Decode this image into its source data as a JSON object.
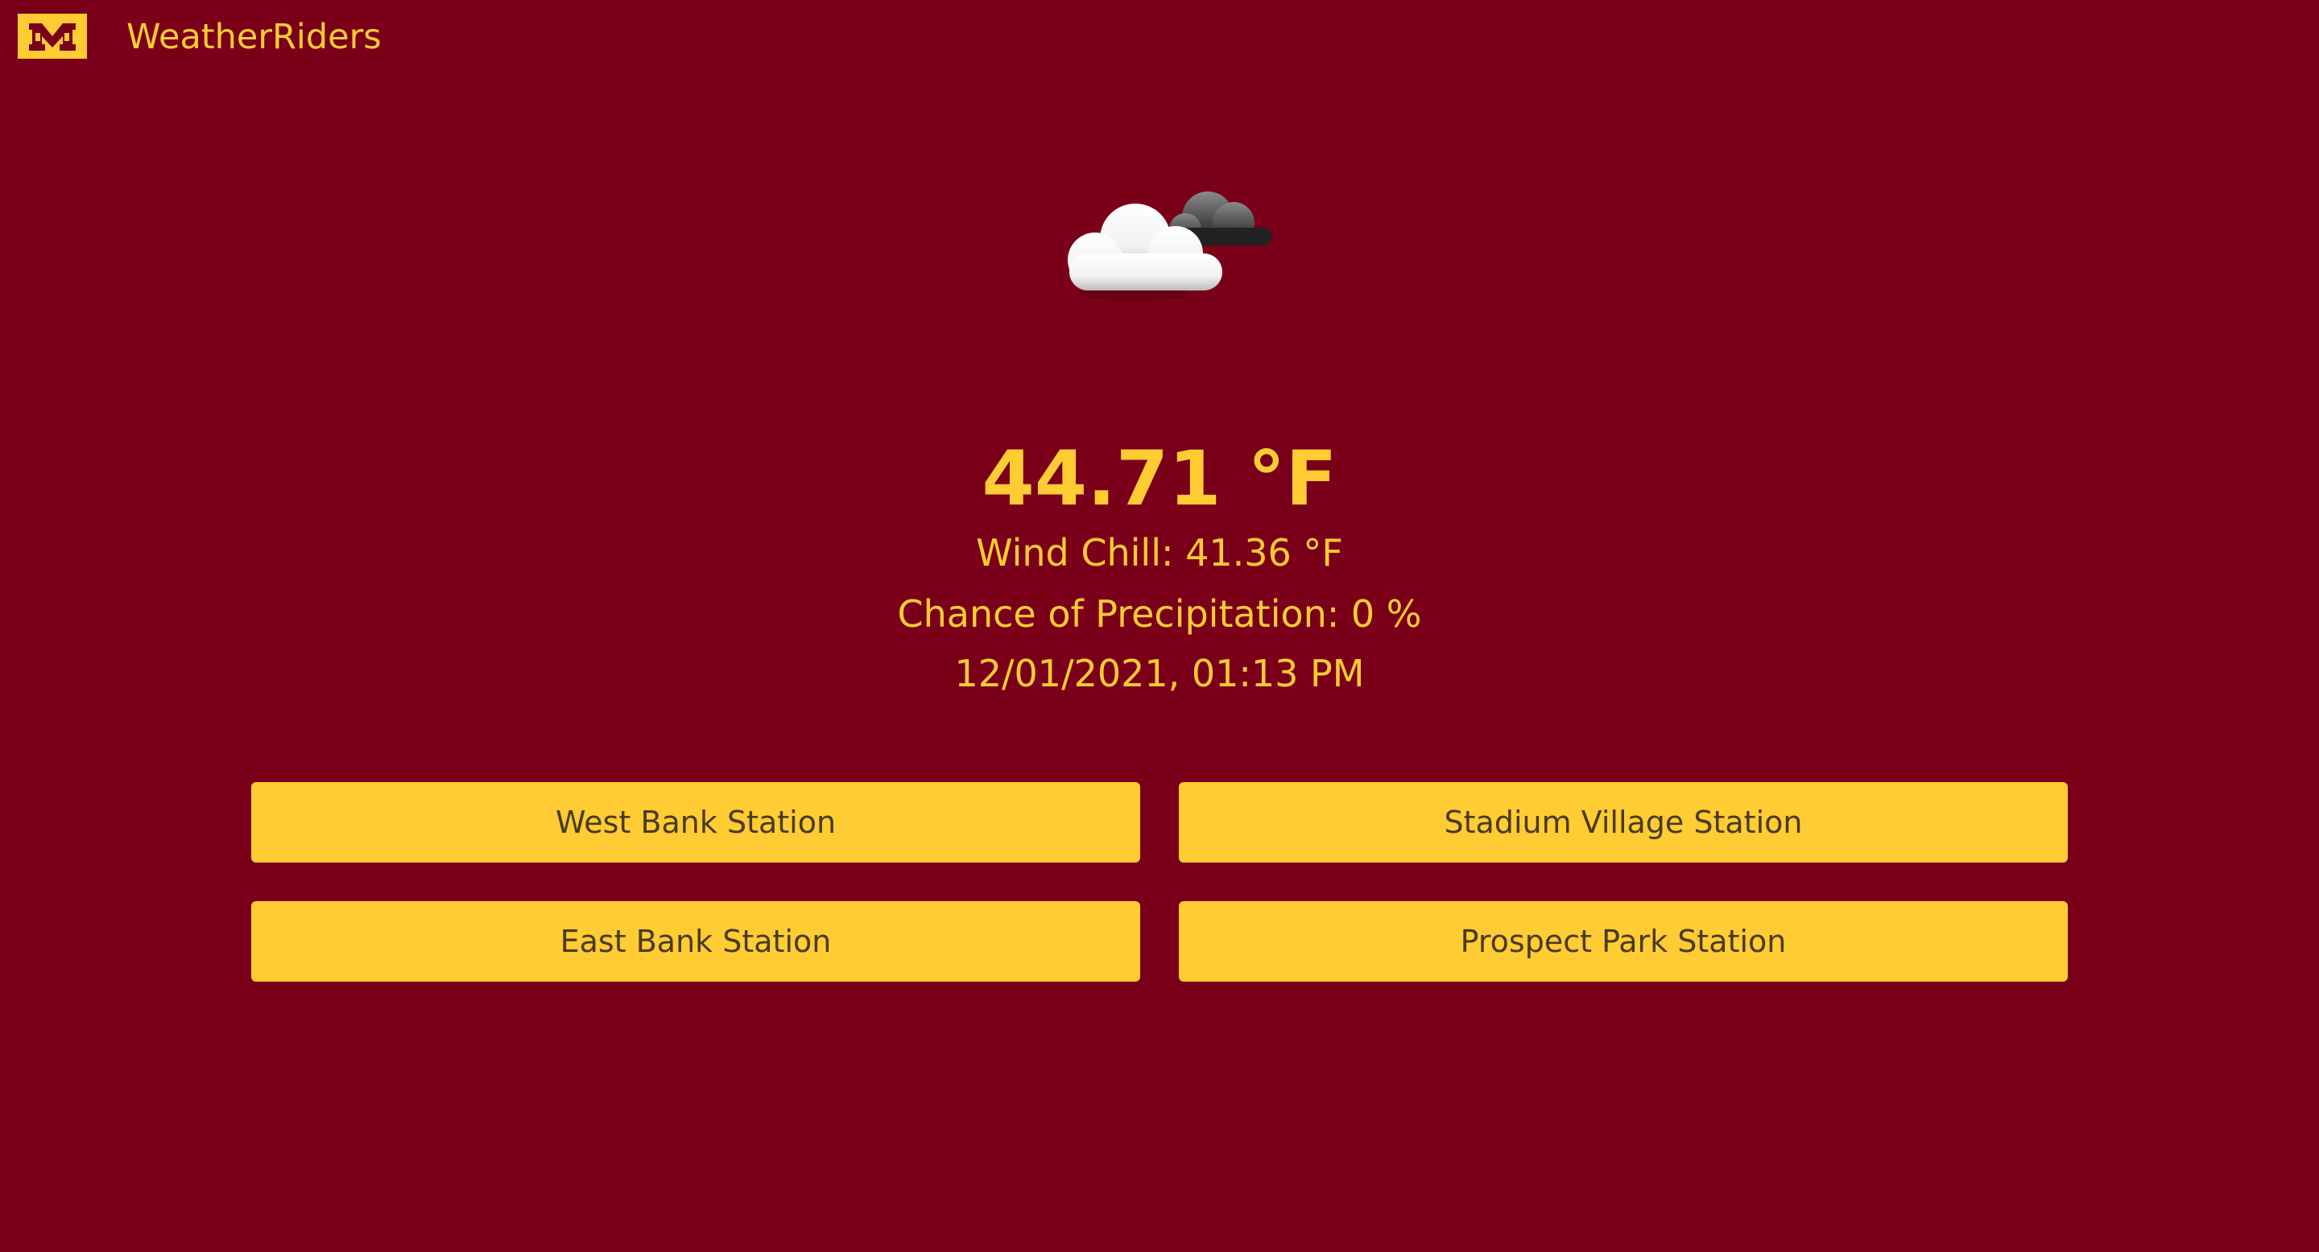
{
  "header": {
    "logo_icon": "university-m-logo",
    "app_title": "WeatherRiders"
  },
  "weather": {
    "icon": "partly-cloudy-icon",
    "temperature": "44.71 °F",
    "wind_chill": "Wind Chill: 41.36 °F",
    "precipitation": "Chance of Precipitation: 0 %",
    "timestamp": "12/01/2021, 01:13 PM"
  },
  "stations": [
    {
      "label": "West Bank Station"
    },
    {
      "label": "Stadium Village Station"
    },
    {
      "label": "East Bank Station"
    },
    {
      "label": "Prospect Park Station"
    }
  ],
  "colors": {
    "background": "#7a0019",
    "accent": "#ffcc33",
    "button_text": "#4a3a1e"
  }
}
